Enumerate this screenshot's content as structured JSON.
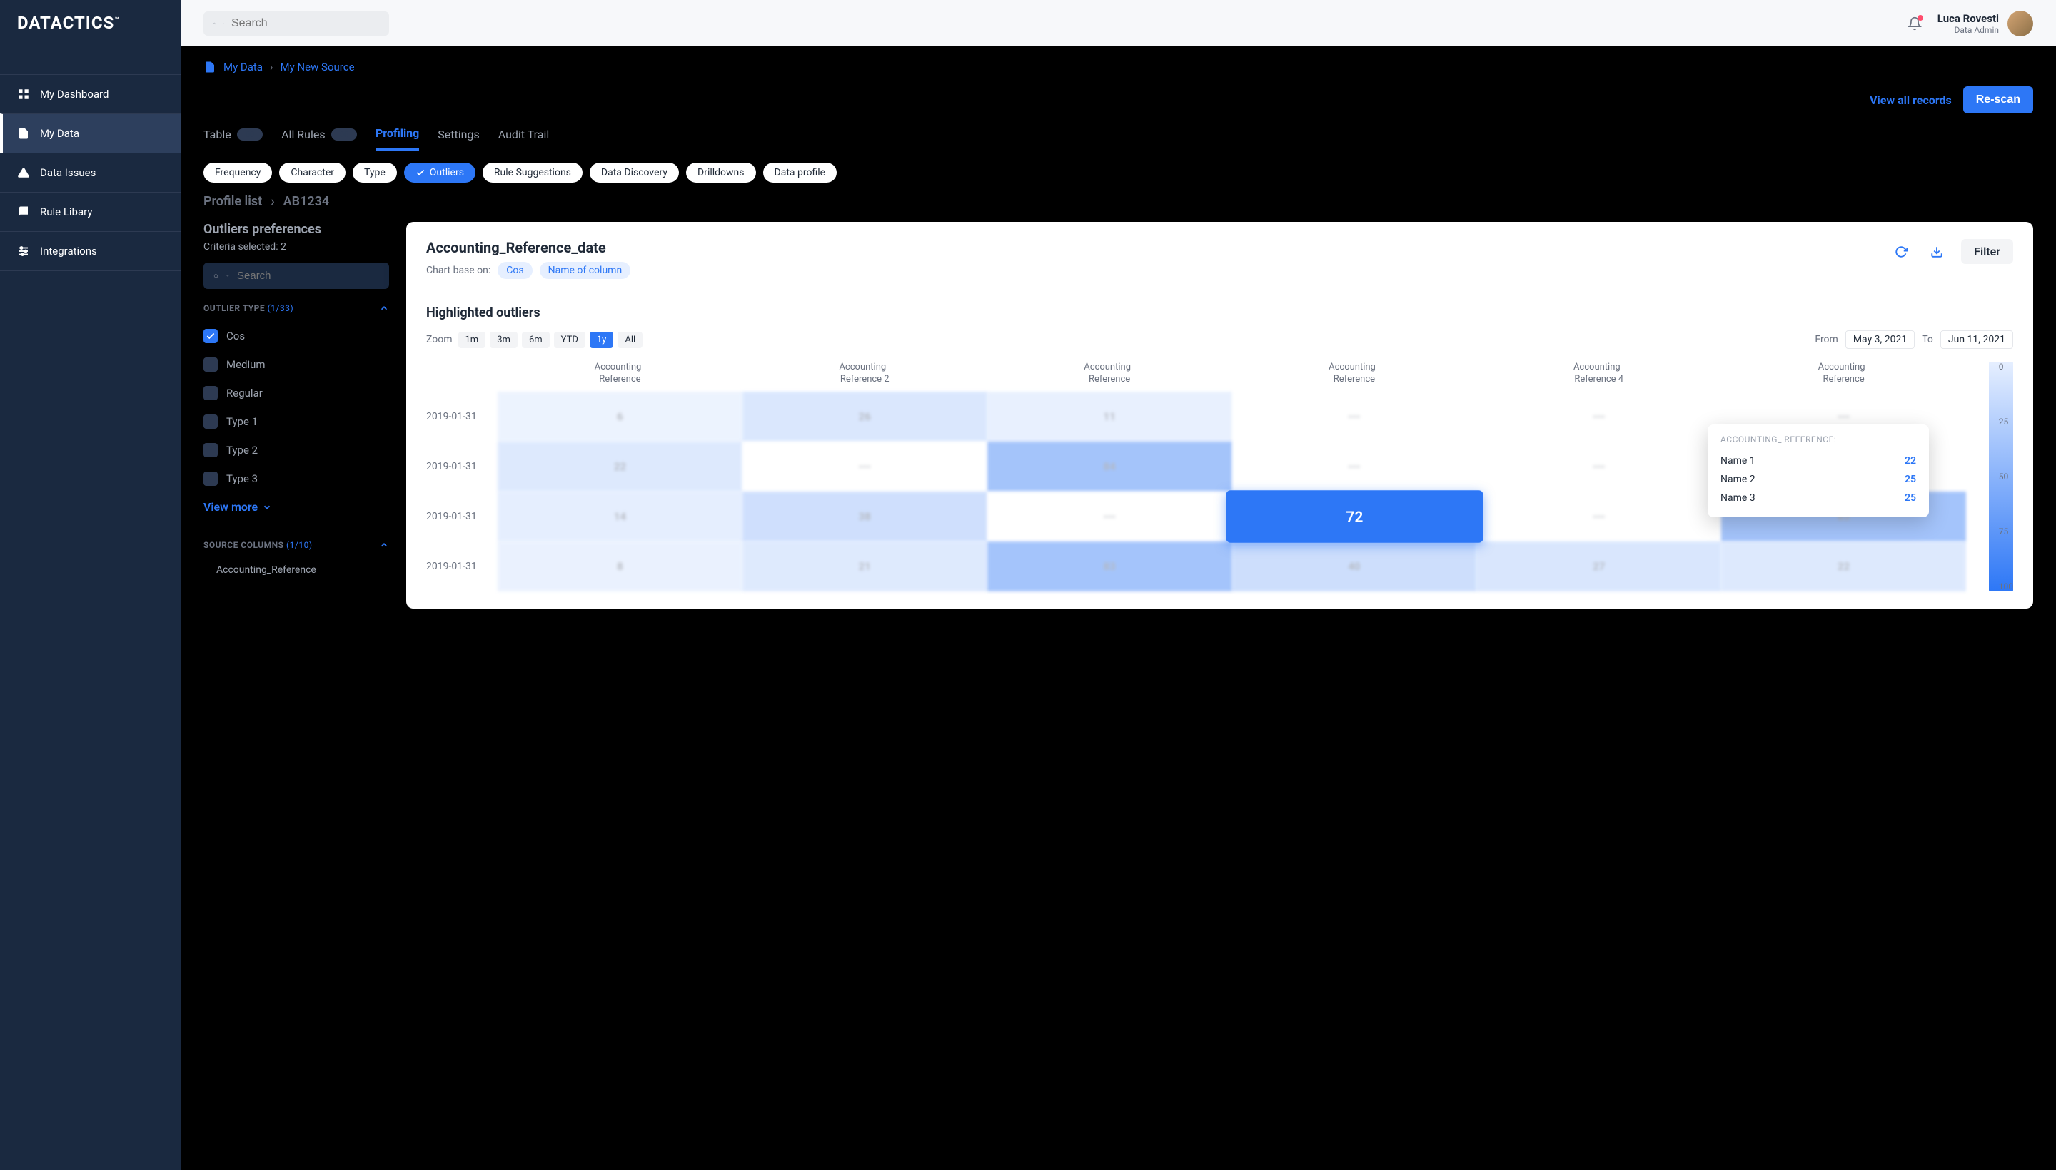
{
  "brand": "DATACTICS",
  "brand_tm": "™",
  "search_placeholder": "Search",
  "user": {
    "name": "Luca Rovesti",
    "role": "Data Admin"
  },
  "nav": [
    {
      "label": "My Dashboard",
      "icon": "dashboard"
    },
    {
      "label": "My Data",
      "icon": "file",
      "active": true
    },
    {
      "label": "Data Issues",
      "icon": "alert"
    },
    {
      "label": "Rule Libary",
      "icon": "book"
    },
    {
      "label": "Integrations",
      "icon": "sliders"
    }
  ],
  "breadcrumb": [
    "My Data",
    "My New Source"
  ],
  "actions": {
    "view_all": "View all records",
    "rescan": "Re-scan"
  },
  "tabs": [
    {
      "label": "Table",
      "badge": true
    },
    {
      "label": "All Rules",
      "badge": true
    },
    {
      "label": "Profiling",
      "active": true
    },
    {
      "label": "Settings"
    },
    {
      "label": "Audit Trail"
    }
  ],
  "chips": [
    "Frequency",
    "Character",
    "Type",
    "Outliers",
    "Rule Suggestions",
    "Data Discovery",
    "Drilldowns",
    "Data profile"
  ],
  "chip_active": 3,
  "profile_list": {
    "label": "Profile list",
    "value": "AB1234"
  },
  "prefs": {
    "title": "Outliers preferences",
    "criteria": "Criteria selected: 2",
    "search_placeholder": "Search",
    "outlier_type": {
      "label": "OUTLIER TYPE",
      "count": "(1/33)"
    },
    "types": [
      {
        "label": "Cos",
        "checked": true
      },
      {
        "label": "Medium"
      },
      {
        "label": "Regular"
      },
      {
        "label": "Type 1"
      },
      {
        "label": "Type 2"
      },
      {
        "label": "Type 3"
      }
    ],
    "view_more": "View more",
    "source_cols": {
      "label": "SOURCE COLUMNS",
      "count": "(1/10)"
    },
    "source_item": "Accounting_Reference"
  },
  "card": {
    "title": "Accounting_Reference_date",
    "subtitle": "Chart base on:",
    "pills": [
      "Cos",
      "Name of column"
    ],
    "filter": "Filter",
    "outliers_title": "Highlighted outliers",
    "zoom_label": "Zoom",
    "zoom_opts": [
      "1m",
      "3m",
      "6m",
      "YTD",
      "1y",
      "All"
    ],
    "zoom_active": 4,
    "from_label": "From",
    "to_label": "To",
    "from": "May 3, 2021",
    "to": "Jun 11, 2021"
  },
  "chart_data": {
    "type": "heatmap",
    "columns": [
      "Accounting_\nReference",
      "Accounting_\nReference 2",
      "Accounting_\nReference",
      "Accounting_\nReference",
      "Accounting_\nReference 4",
      "Accounting_\nReference"
    ],
    "rows": [
      {
        "label": "2019-01-31",
        "values": [
          6,
          26,
          11,
          null,
          null,
          null
        ]
      },
      {
        "label": "2019-01-31",
        "values": [
          22,
          null,
          84,
          null,
          null,
          null
        ]
      },
      {
        "label": "2019-01-31",
        "values": [
          14,
          38,
          null,
          72,
          null,
          83
        ]
      },
      {
        "label": "2019-01-31",
        "values": [
          8,
          21,
          83,
          40,
          27,
          22
        ]
      }
    ],
    "highlight": {
      "row": 2,
      "col": 3
    },
    "legend": [
      0,
      25,
      50,
      75,
      100
    ]
  },
  "tooltip": {
    "title": "ACCOUNTING_ REFERENCE:",
    "rows": [
      {
        "name": "Name 1",
        "value": "22"
      },
      {
        "name": "Name 2",
        "value": "25"
      },
      {
        "name": "Name 3",
        "value": "25"
      }
    ]
  }
}
